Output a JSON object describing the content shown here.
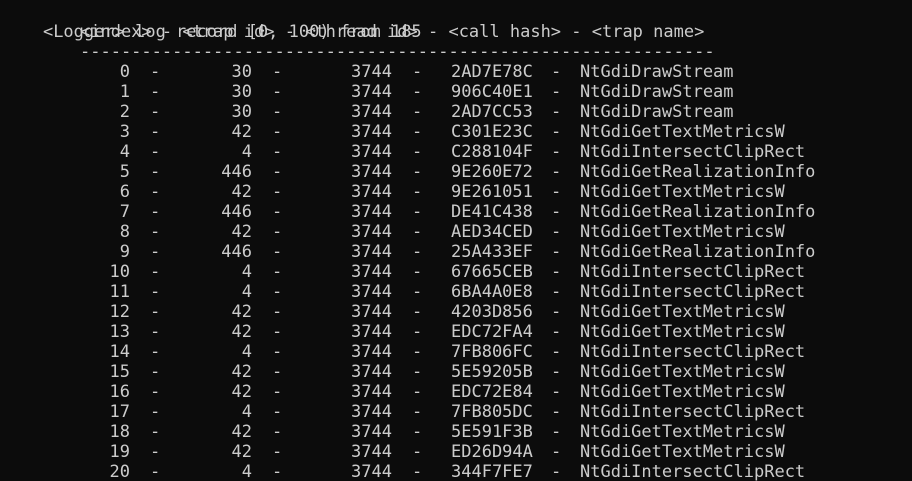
{
  "console": {
    "prompt": "<Logger>",
    "command": "log record [0, 100) from 185",
    "header": "<index> - <trap id> - <thread id> - <call hash> - <trap name>",
    "separator": "--------------------------------------------------------------",
    "dash": "-",
    "rows": [
      {
        "index": "0",
        "trap_id": "30",
        "thread_id": "3744",
        "call_hash": "2AD7E78C",
        "trap_name": "NtGdiDrawStream"
      },
      {
        "index": "1",
        "trap_id": "30",
        "thread_id": "3744",
        "call_hash": "906C40E1",
        "trap_name": "NtGdiDrawStream"
      },
      {
        "index": "2",
        "trap_id": "30",
        "thread_id": "3744",
        "call_hash": "2AD7CC53",
        "trap_name": "NtGdiDrawStream"
      },
      {
        "index": "3",
        "trap_id": "42",
        "thread_id": "3744",
        "call_hash": "C301E23C",
        "trap_name": "NtGdiGetTextMetricsW"
      },
      {
        "index": "4",
        "trap_id": "4",
        "thread_id": "3744",
        "call_hash": "C288104F",
        "trap_name": "NtGdiIntersectClipRect"
      },
      {
        "index": "5",
        "trap_id": "446",
        "thread_id": "3744",
        "call_hash": "9E260E72",
        "trap_name": "NtGdiGetRealizationInfo"
      },
      {
        "index": "6",
        "trap_id": "42",
        "thread_id": "3744",
        "call_hash": "9E261051",
        "trap_name": "NtGdiGetTextMetricsW"
      },
      {
        "index": "7",
        "trap_id": "446",
        "thread_id": "3744",
        "call_hash": "DE41C438",
        "trap_name": "NtGdiGetRealizationInfo"
      },
      {
        "index": "8",
        "trap_id": "42",
        "thread_id": "3744",
        "call_hash": "AED34CED",
        "trap_name": "NtGdiGetTextMetricsW"
      },
      {
        "index": "9",
        "trap_id": "446",
        "thread_id": "3744",
        "call_hash": "25A433EF",
        "trap_name": "NtGdiGetRealizationInfo"
      },
      {
        "index": "10",
        "trap_id": "4",
        "thread_id": "3744",
        "call_hash": "67665CEB",
        "trap_name": "NtGdiIntersectClipRect"
      },
      {
        "index": "11",
        "trap_id": "4",
        "thread_id": "3744",
        "call_hash": "6BA4A0E8",
        "trap_name": "NtGdiIntersectClipRect"
      },
      {
        "index": "12",
        "trap_id": "42",
        "thread_id": "3744",
        "call_hash": "4203D856",
        "trap_name": "NtGdiGetTextMetricsW"
      },
      {
        "index": "13",
        "trap_id": "42",
        "thread_id": "3744",
        "call_hash": "EDC72FA4",
        "trap_name": "NtGdiGetTextMetricsW"
      },
      {
        "index": "14",
        "trap_id": "4",
        "thread_id": "3744",
        "call_hash": "7FB806FC",
        "trap_name": "NtGdiIntersectClipRect"
      },
      {
        "index": "15",
        "trap_id": "42",
        "thread_id": "3744",
        "call_hash": "5E59205B",
        "trap_name": "NtGdiGetTextMetricsW"
      },
      {
        "index": "16",
        "trap_id": "42",
        "thread_id": "3744",
        "call_hash": "EDC72E84",
        "trap_name": "NtGdiGetTextMetricsW"
      },
      {
        "index": "17",
        "trap_id": "4",
        "thread_id": "3744",
        "call_hash": "7FB805DC",
        "trap_name": "NtGdiIntersectClipRect"
      },
      {
        "index": "18",
        "trap_id": "42",
        "thread_id": "3744",
        "call_hash": "5E591F3B",
        "trap_name": "NtGdiGetTextMetricsW"
      },
      {
        "index": "19",
        "trap_id": "42",
        "thread_id": "3744",
        "call_hash": "ED26D94A",
        "trap_name": "NtGdiGetTextMetricsW"
      },
      {
        "index": "20",
        "trap_id": "4",
        "thread_id": "3744",
        "call_hash": "344F7FE7",
        "trap_name": "NtGdiIntersectClipRect"
      }
    ]
  },
  "colors": {
    "background": "#0c0c0c",
    "text": "#cccccc"
  }
}
